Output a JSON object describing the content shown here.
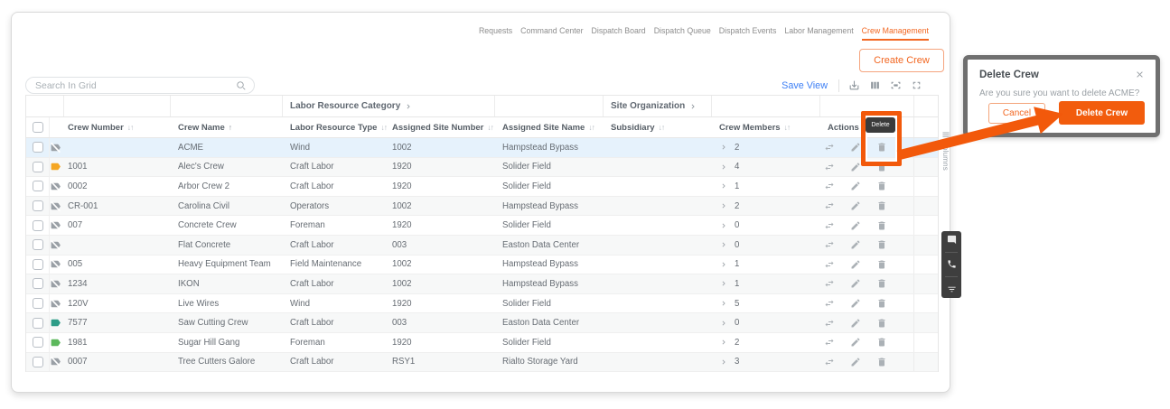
{
  "nav": {
    "tabs": [
      {
        "label": "Requests",
        "active": false
      },
      {
        "label": "Command Center",
        "active": false
      },
      {
        "label": "Dispatch Board",
        "active": false
      },
      {
        "label": "Dispatch Queue",
        "active": false
      },
      {
        "label": "Dispatch Events",
        "active": false
      },
      {
        "label": "Labor Management",
        "active": false
      },
      {
        "label": "Crew Management",
        "active": true
      }
    ]
  },
  "toolbar": {
    "create_crew_label": "Create Crew",
    "search_placeholder": "Search In Grid",
    "save_view_label": "Save View"
  },
  "grid": {
    "group_headers": {
      "labor_resource_category": "Labor Resource Category",
      "site_organization": "Site Organization"
    },
    "columns": [
      {
        "label": "Crew Number",
        "sort": "both"
      },
      {
        "label": "Crew Name",
        "sort": "asc"
      },
      {
        "label": "Labor Resource Type",
        "sort": "both"
      },
      {
        "label": "Assigned Site Number",
        "sort": "both"
      },
      {
        "label": "Assigned Site Name",
        "sort": "both"
      },
      {
        "label": "Subsidiary",
        "sort": "both"
      },
      {
        "label": "Crew Members",
        "sort": "both"
      },
      {
        "label": "Actions",
        "sort": "none"
      }
    ],
    "side_panel_label": "Columns",
    "rows": [
      {
        "flag": "gray-off",
        "crew_number": "",
        "crew_name": "ACME",
        "labor_resource_type": "Wind",
        "assigned_site_number": "1002",
        "assigned_site_name": "Hampstead Bypass",
        "subsidiary": "",
        "crew_members": "2",
        "selected": true
      },
      {
        "flag": "orange",
        "crew_number": "1001",
        "crew_name": "Alec's Crew",
        "labor_resource_type": "Craft Labor",
        "assigned_site_number": "1920",
        "assigned_site_name": "Solider Field",
        "subsidiary": "",
        "crew_members": "4",
        "selected": false
      },
      {
        "flag": "gray-off",
        "crew_number": "0002",
        "crew_name": "Arbor Crew 2",
        "labor_resource_type": "Craft Labor",
        "assigned_site_number": "1920",
        "assigned_site_name": "Solider Field",
        "subsidiary": "",
        "crew_members": "1",
        "selected": false
      },
      {
        "flag": "gray-off",
        "crew_number": "CR-001",
        "crew_name": "Carolina Civil",
        "labor_resource_type": "Operators",
        "assigned_site_number": "1002",
        "assigned_site_name": "Hampstead Bypass",
        "subsidiary": "",
        "crew_members": "2",
        "selected": false
      },
      {
        "flag": "gray-off",
        "crew_number": "007",
        "crew_name": "Concrete Crew",
        "labor_resource_type": "Foreman",
        "assigned_site_number": "1920",
        "assigned_site_name": "Solider Field",
        "subsidiary": "",
        "crew_members": "0",
        "selected": false
      },
      {
        "flag": "gray-off",
        "crew_number": "",
        "crew_name": "Flat Concrete",
        "labor_resource_type": "Craft Labor",
        "assigned_site_number": "003",
        "assigned_site_name": "Easton Data Center",
        "subsidiary": "",
        "crew_members": "0",
        "selected": false
      },
      {
        "flag": "gray-off",
        "crew_number": "005",
        "crew_name": "Heavy Equipment Team",
        "labor_resource_type": "Field Maintenance",
        "assigned_site_number": "1002",
        "assigned_site_name": "Hampstead Bypass",
        "subsidiary": "",
        "crew_members": "1",
        "selected": false
      },
      {
        "flag": "gray-off",
        "crew_number": "1234",
        "crew_name": "IKON",
        "labor_resource_type": "Craft Labor",
        "assigned_site_number": "1002",
        "assigned_site_name": "Hampstead Bypass",
        "subsidiary": "",
        "crew_members": "1",
        "selected": false
      },
      {
        "flag": "gray-off",
        "crew_number": "120V",
        "crew_name": "Live Wires",
        "labor_resource_type": "Wind",
        "assigned_site_number": "1920",
        "assigned_site_name": "Solider Field",
        "subsidiary": "",
        "crew_members": "5",
        "selected": false
      },
      {
        "flag": "teal",
        "crew_number": "7577",
        "crew_name": "Saw Cutting Crew",
        "labor_resource_type": "Craft Labor",
        "assigned_site_number": "003",
        "assigned_site_name": "Easton Data Center",
        "subsidiary": "",
        "crew_members": "0",
        "selected": false
      },
      {
        "flag": "green",
        "crew_number": "1981",
        "crew_name": "Sugar Hill Gang",
        "labor_resource_type": "Foreman",
        "assigned_site_number": "1920",
        "assigned_site_name": "Solider Field",
        "subsidiary": "",
        "crew_members": "2",
        "selected": false
      },
      {
        "flag": "gray-off",
        "crew_number": "0007",
        "crew_name": "Tree Cutters Galore",
        "labor_resource_type": "Craft Labor",
        "assigned_site_number": "RSY1",
        "assigned_site_name": "Rialto Storage Yard",
        "subsidiary": "",
        "crew_members": "3",
        "selected": false
      }
    ]
  },
  "tooltip": {
    "label": "Delete"
  },
  "dialog": {
    "title": "Delete Crew",
    "message": "Are you sure you want to delete ACME?",
    "cancel_label": "Cancel",
    "confirm_label": "Delete Crew"
  },
  "colors": {
    "accent": "#F26722",
    "annotation": "#F2590B",
    "save_view_link": "#3D7FF5",
    "flag_orange": "#F5A623",
    "flag_teal": "#2E9D88",
    "flag_green": "#5CB85C",
    "flag_gray": "#9AA0A6"
  }
}
